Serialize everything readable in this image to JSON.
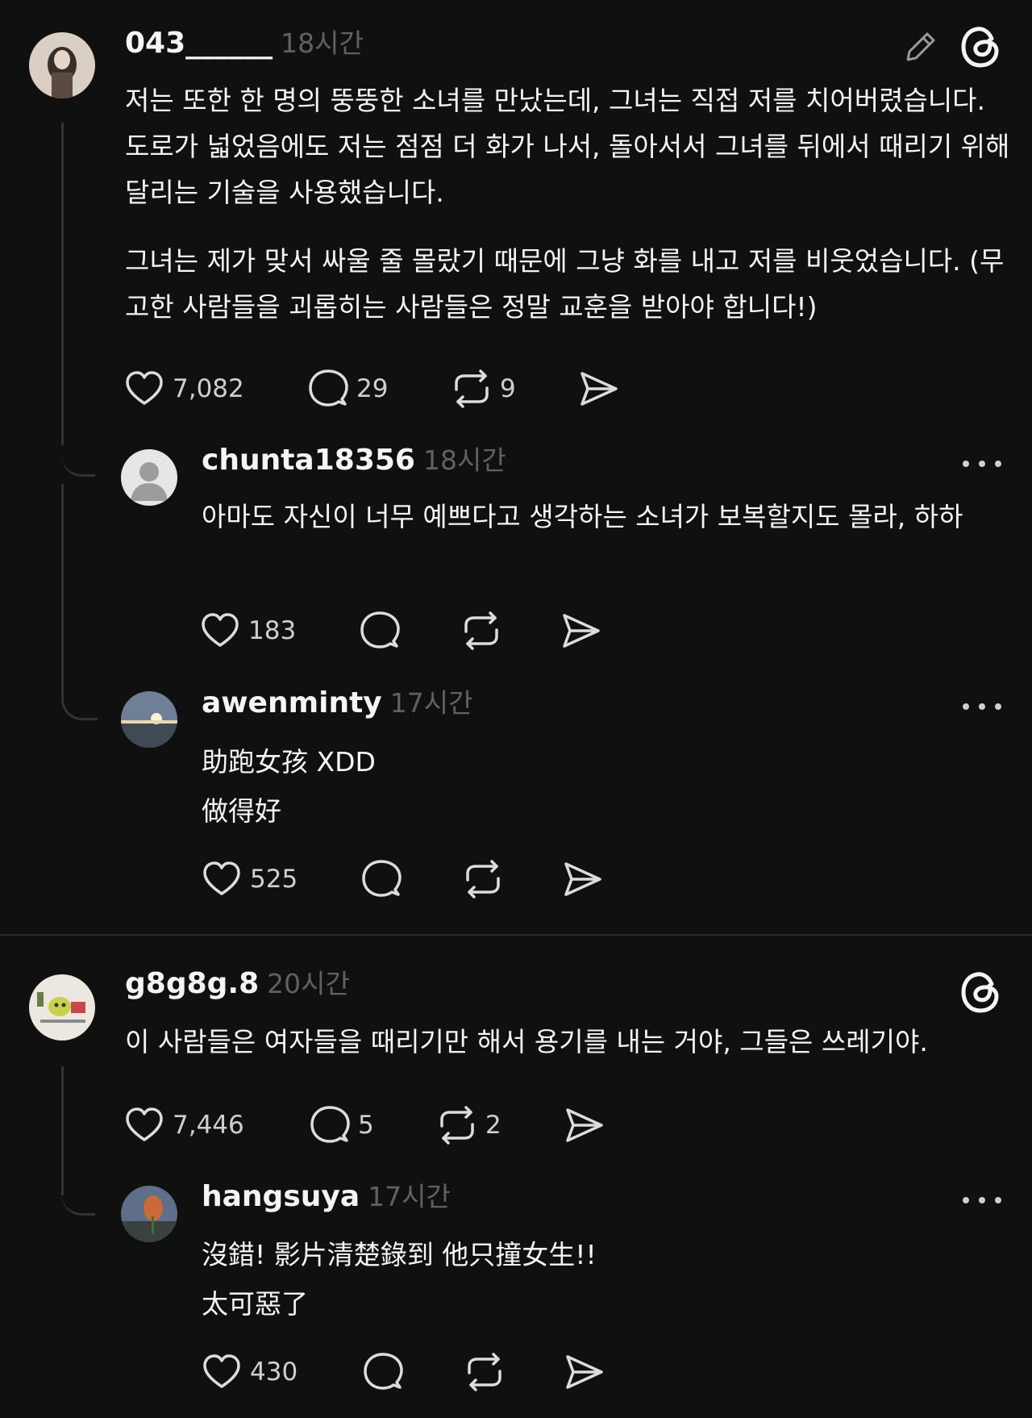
{
  "post1": {
    "username": "043______",
    "time": "18시간",
    "body_p1": "저는 또한 한 명의 뚱뚱한 소녀를 만났는데, 그녀는 직접 저를 치어버렸습니다. 도로가 넓었음에도 저는 점점 더 화가 나서, 돌아서서 그녀를 뒤에서 때리기 위해 달리는 기술을 사용했습니다.",
    "body_p2": "그녀는 제가 맞서 싸울 줄 몰랐기 때문에 그냥 화를 내고 저를 비웃었습니다. (무고한 사람들을 괴롭히는 사람들은 정말 교훈을 받아야 합니다!)",
    "likes": "7,082",
    "replies": "29",
    "reposts": "9",
    "icons": [
      "edit-icon",
      "threads-logo-icon"
    ]
  },
  "reply1": {
    "username": "chunta18356",
    "time": "18시간",
    "body": "아마도 자신이 너무 예쁘다고 생각하는 소녀가 보복할지도 몰라, 하하",
    "likes": "183"
  },
  "reply2": {
    "username": "awenminty",
    "time": "17시간",
    "line1": "助跑女孩 XDD",
    "line2": "做得好",
    "likes": "525"
  },
  "post2": {
    "username": "g8g8g.8",
    "time": "20시간",
    "body": "이 사람들은 여자들을 때리기만 해서 용기를 내는 거야, 그들은 쓰레기야.",
    "likes": "7,446",
    "replies": "5",
    "reposts": "2"
  },
  "reply3": {
    "username": "hangsuya",
    "time": "17시간",
    "line1": "沒錯! 影片清楚錄到 他只撞女生!!",
    "line2": "太可惡了",
    "likes": "430"
  },
  "colors": {
    "background": "#101010",
    "text": "#f3f5f7",
    "muted": "#616161"
  }
}
